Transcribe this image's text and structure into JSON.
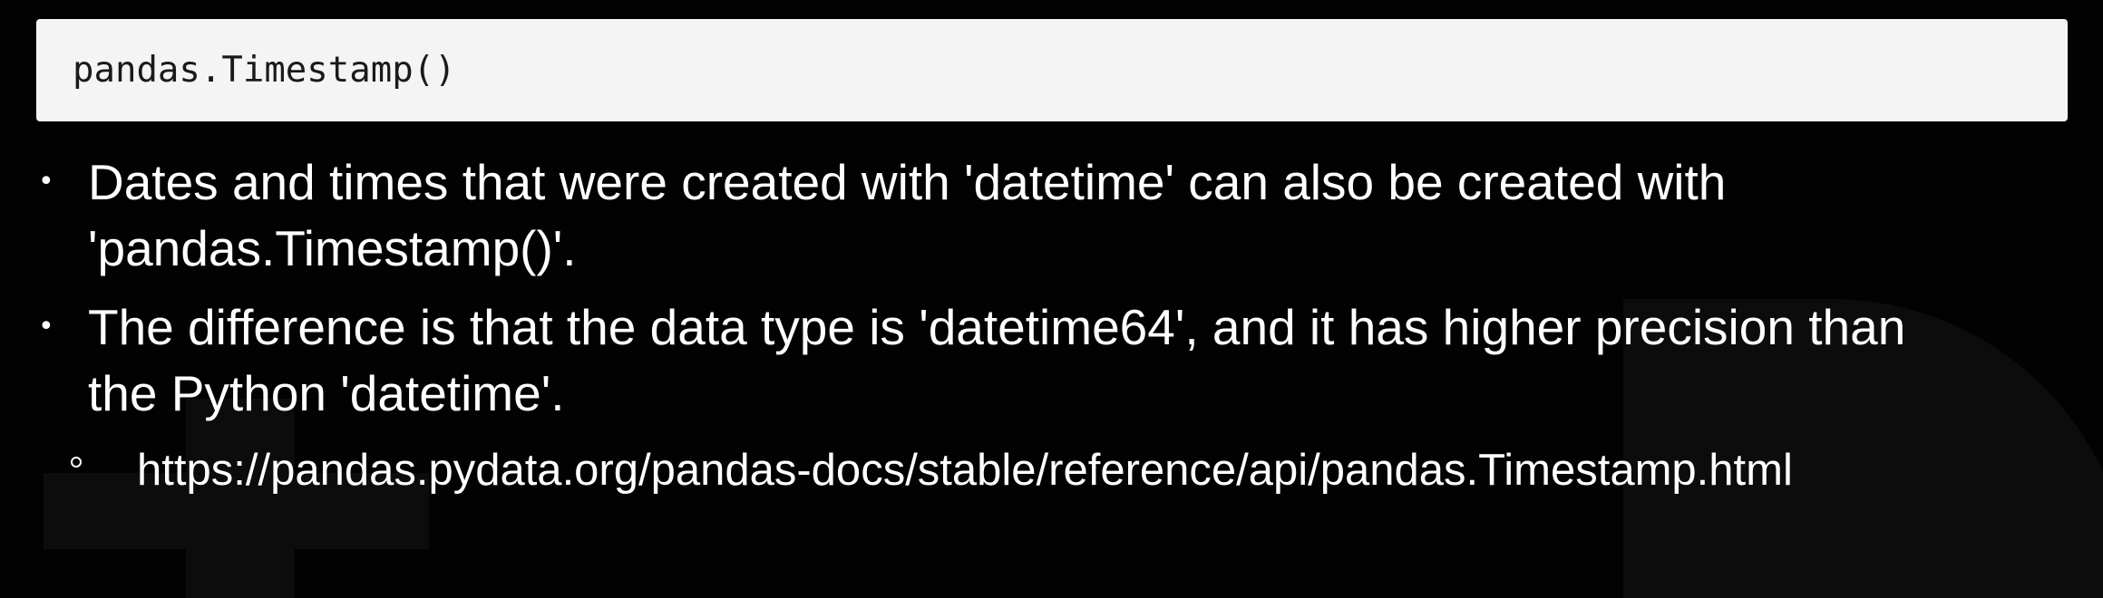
{
  "code": {
    "text": "pandas.Timestamp()"
  },
  "bullets": [
    {
      "lines": [
        "Dates and times that were created with 'datetime' can also be created with",
        "'pandas.Timestamp()'."
      ]
    },
    {
      "lines": [
        "The difference is that the data type is 'datetime64', and it has higher precision than",
        "the Python 'datetime'."
      ]
    }
  ],
  "sub_bullets": [
    {
      "text": "https://pandas.pydata.org/pandas-docs/stable/reference/api/pandas.Timestamp.html"
    }
  ],
  "colors": {
    "background": "#020202",
    "code_box": "#f4f4f4",
    "text": "#ffffff"
  }
}
